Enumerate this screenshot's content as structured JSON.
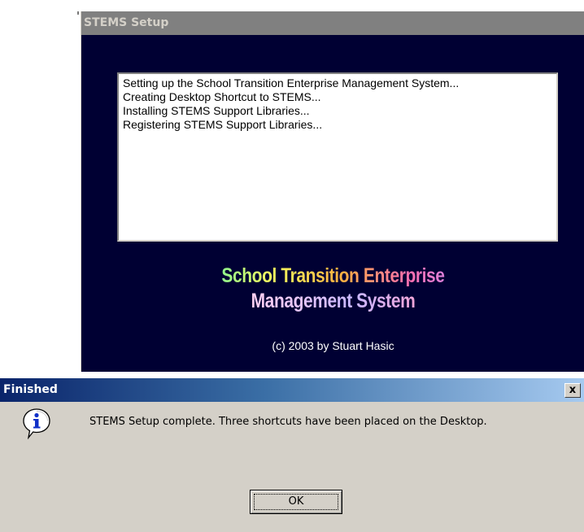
{
  "setup_window": {
    "title": "STEMS Setup",
    "log_lines": [
      "Setting up the School Transition Enterprise Management System...",
      "Creating Desktop Shortcut to STEMS...",
      "Installing STEMS Support Libraries...",
      "Registering STEMS Support Libraries..."
    ],
    "logo_line_1": "School Transition Enterprise",
    "logo_line_2": "Management System",
    "copyright": "(c) 2003 by Stuart Hasic",
    "background_color": "#000033"
  },
  "dialog": {
    "title": "Finished",
    "close_label": "x",
    "message": "STEMS Setup complete.  Three shortcuts have been placed on the Desktop.",
    "ok_label": "OK",
    "icon": "info-icon",
    "titlebar_colors": [
      "#0a246a",
      "#a6caf0"
    ]
  }
}
